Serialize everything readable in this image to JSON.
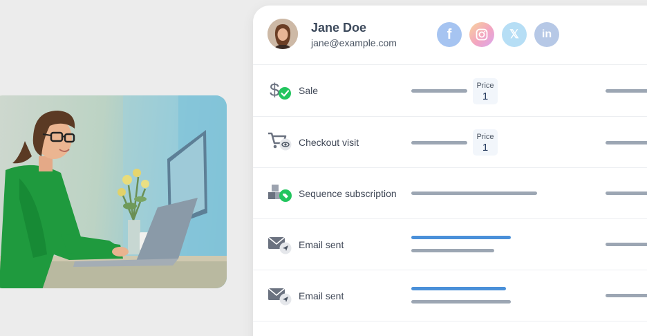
{
  "profile": {
    "name": "Jane Doe",
    "email": "jane@example.com"
  },
  "social": {
    "facebook": "f",
    "x": "𝕏",
    "linkedin": "in"
  },
  "activities": [
    {
      "label": "Sale",
      "icon": "dollar-check-icon",
      "price_label": "Price",
      "price_value": "1"
    },
    {
      "label": "Checkout visit",
      "icon": "cart-eye-icon",
      "price_label": "Price",
      "price_value": "1"
    },
    {
      "label": "Sequence subscription",
      "icon": "boxes-tag-icon"
    },
    {
      "label": "Email sent",
      "icon": "envelope-send-icon"
    },
    {
      "label": "Email sent",
      "icon": "envelope-send-icon"
    }
  ],
  "colors": {
    "accent_blue": "#4a90d9",
    "bar_gray": "#9ca6b3",
    "success_green": "#22c55e"
  }
}
